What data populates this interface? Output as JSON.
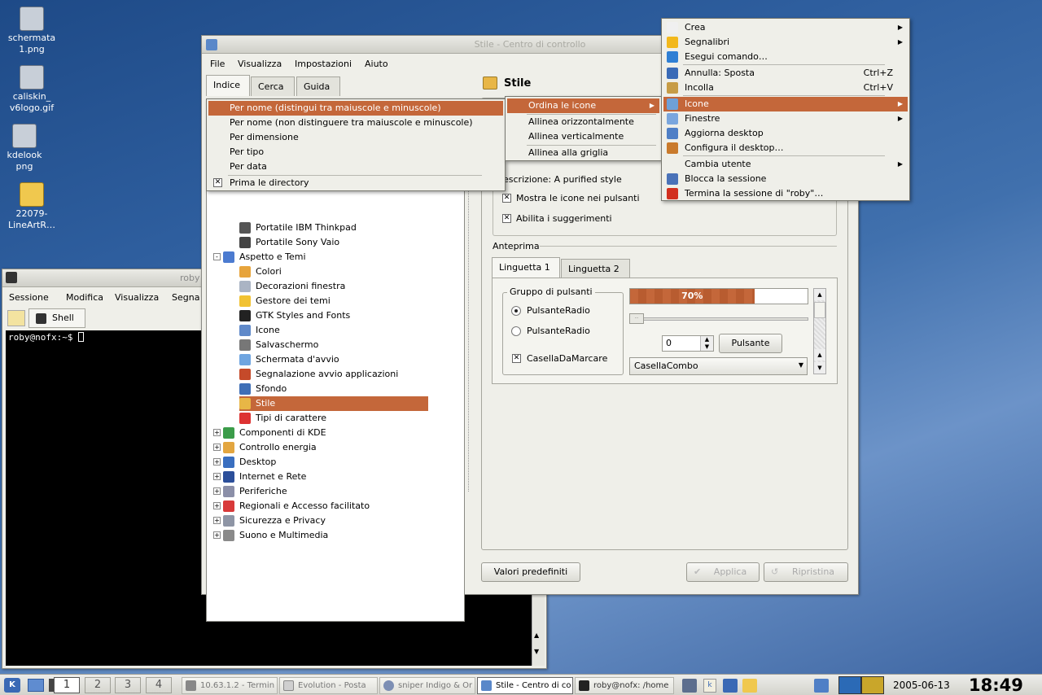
{
  "desktop_icons": [
    {
      "label": "schermata\n1.png",
      "color": "#bcc3cc"
    },
    {
      "label": "caliskin_\nv6logo.gif",
      "color": "#bcc3cc"
    },
    {
      "label": "kdelook\npng",
      "color": "#bcc3cc"
    },
    {
      "label": "22079-\nLineArtR…",
      "color": "#e8c44a"
    }
  ],
  "konsole": {
    "title": "roby",
    "menu": [
      "Sessione",
      "Modifica",
      "Visualizza",
      "Segna"
    ],
    "tab": "Shell",
    "prompt": "roby@nofx:~$ "
  },
  "kcontrol": {
    "title": "Stile - Centro di controllo",
    "menu": [
      "File",
      "Visualizza",
      "Impostazioni",
      "Aiuto"
    ],
    "tabs": [
      "Indice",
      "Cerca",
      "Guida"
    ],
    "tree_items": [
      {
        "label": "Portatile IBM Thinkpad",
        "color": "#555"
      },
      {
        "label": "Portatile Sony Vaio",
        "color": "#444"
      },
      {
        "label": "Aspetto e Temi",
        "color": "#4c7bd0"
      },
      {
        "label": "Colori",
        "color": "#e7a43c"
      },
      {
        "label": "Decorazioni finestra",
        "color": "#aab4c4"
      },
      {
        "label": "Gestore dei temi",
        "color": "#f1c232"
      },
      {
        "label": "GTK Styles and Fonts",
        "color": "#222"
      },
      {
        "label": "Icone",
        "color": "#5f89c9"
      },
      {
        "label": "Salvaschermo",
        "color": "#777"
      },
      {
        "label": "Schermata d'avvio",
        "color": "#6fa5e0"
      },
      {
        "label": "Segnalazione avvio applicazioni",
        "color": "#c54a2a"
      },
      {
        "label": "Sfondo",
        "color": "#3f6fb6"
      },
      {
        "label": "Stile",
        "color": "#e8b646"
      },
      {
        "label": "Tipi di carattere",
        "color": "#d33"
      },
      {
        "label": "Componenti di KDE",
        "color": "#3b9c4a"
      },
      {
        "label": "Controllo energia",
        "color": "#e3a640"
      },
      {
        "label": "Desktop",
        "color": "#3a6fc0"
      },
      {
        "label": "Internet e Rete",
        "color": "#2c4f9a"
      },
      {
        "label": "Periferiche",
        "color": "#8b8fa8"
      },
      {
        "label": "Regionali e Accesso facilitato",
        "color": "#d83a3a"
      },
      {
        "label": "Sicurezza e Privacy",
        "color": "#8e95a5"
      },
      {
        "label": "Suono e Multimedia",
        "color": "#8a8a8a"
      }
    ],
    "module_title": "Stile",
    "description": "escrizione: A purified style",
    "checks": [
      {
        "label": "Mostra le icone nei pulsanti",
        "checked": true
      },
      {
        "label": "Abilita i suggerimenti",
        "checked": true
      }
    ],
    "preview_label": "Anteprima",
    "preview_tabs": [
      "Linguetta 1",
      "Linguetta 2"
    ],
    "group_label": "Gruppo di pulsanti",
    "radios": [
      {
        "label": "PulsanteRadio",
        "checked": true
      },
      {
        "label": "PulsanteRadio",
        "checked": false
      }
    ],
    "checkbox_label": "CasellaDaMarcare",
    "progress": {
      "text": "70%",
      "value": 0.7
    },
    "spin_value": "0",
    "push_button": "Pulsante",
    "combo": "CasellaCombo",
    "btn_defaults": "Valori predefiniti",
    "btn_apply": "Applica",
    "btn_reset": "Ripristina"
  },
  "sort_menu": {
    "items": [
      {
        "label": "Per nome (distingui tra maiuscole e minuscole)",
        "highlight": true
      },
      {
        "label": "Per nome (non distinguere tra maiuscole e minuscole)"
      },
      {
        "label": "Per dimensione"
      },
      {
        "label": "Per tipo"
      },
      {
        "label": "Per data"
      },
      {
        "label": "Prima le directory",
        "checked": true
      }
    ]
  },
  "icons_menu": {
    "items": [
      "Ordina le icone",
      "Allinea orizzontalmente",
      "Allinea verticalmente",
      "Allinea alla griglia"
    ]
  },
  "desktop_menu": {
    "items": [
      {
        "label": "Crea",
        "sub": true,
        "icon": "#f0f0f0"
      },
      {
        "label": "Segnalibri",
        "sub": true,
        "icon": "#f2b81c"
      },
      {
        "label": "Esegui comando…",
        "icon": "#2f7fd4"
      },
      {
        "label": "Annulla: Sposta",
        "shortcut": "Ctrl+Z",
        "icon": "#3a6bb7"
      },
      {
        "label": "Incolla",
        "shortcut": "Ctrl+V",
        "icon": "#c79c46"
      },
      {
        "label": "Icone",
        "sub": true,
        "highlight": true,
        "icon": "#6ea0d8"
      },
      {
        "label": "Finestre",
        "sub": true,
        "icon": "#7aa6de"
      },
      {
        "label": "Aggiorna desktop",
        "icon": "#4f7fc6"
      },
      {
        "label": "Configura il desktop…",
        "icon": "#c97a2c"
      },
      {
        "label": "Cambia utente",
        "sub": true,
        "icon": ""
      },
      {
        "label": "Blocca la sessione",
        "icon": "#4a72b8"
      },
      {
        "label": "Termina la sessione di \"roby\"…",
        "icon": "#d2301f"
      }
    ]
  },
  "taskbar": {
    "desktops": [
      "1",
      "2",
      "3",
      "4"
    ],
    "tasks": [
      "10.63.1.2 - Termin",
      "Evolution - Posta",
      "sniper Indigo & Or",
      "Stile - Centro di co",
      "roby@nofx: /home"
    ],
    "date": "2005-06-13",
    "clock": "18:49"
  }
}
